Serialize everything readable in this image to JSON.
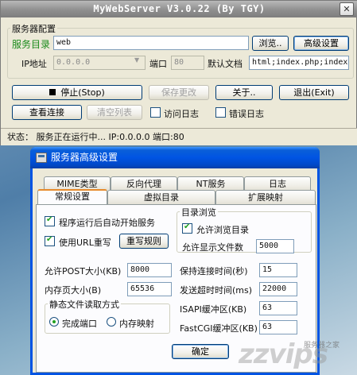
{
  "main": {
    "title": "MyWebServer V3.0.22 (By TGY)",
    "close_glyph": "✕",
    "group_title": "服务器配置",
    "dir_label": "服务目录",
    "dir_value": "web",
    "browse_label": "浏览..",
    "advanced_label": "高级设置",
    "ip_label": "IP地址",
    "ip_value": "0.0.0.0",
    "port_label": "端口",
    "port_value": "80",
    "default_doc_label": "默认文档",
    "default_doc_value": "html;index.php;index",
    "stop_label": "停止(Stop)",
    "save_label": "保存更改",
    "about_label": "关于..",
    "exit_label": "退出(Exit)",
    "view_conn_label": "查看连接",
    "clear_list_label": "清空列表",
    "access_log_label": "访问日志",
    "error_log_label": "错误日志",
    "status_text": "状态：  服务正在运行中...   IP:0.0.0.0   端口:80"
  },
  "dialog": {
    "title": "服务器高级设置",
    "tabs_row1": [
      "MIME类型",
      "反向代理",
      "NT服务",
      "日志"
    ],
    "tabs_row2": [
      "常规设置",
      "虚拟目录",
      "扩展映射"
    ],
    "auto_start_label": "程序运行后自动开始服务",
    "url_rewrite_label": "使用URL重写",
    "rewrite_rules_label": "重写规则",
    "dir_browse_group": "目录浏览",
    "allow_browse_label": "允许浏览目录",
    "max_files_label": "允许显示文件数",
    "max_files_value": "5000",
    "post_size_label": "允许POST大小(KB)",
    "post_size_value": "8000",
    "keepalive_label": "保持连接时间(秒)",
    "keepalive_value": "15",
    "mem_page_label": "内存页大小(B)",
    "mem_page_value": "65536",
    "send_timeout_label": "发送超时时间(ms)",
    "send_timeout_value": "22000",
    "isapi_buffer_label": "ISAPI缓冲区(KB)",
    "isapi_buffer_value": "63",
    "fastcgi_buffer_label": "FastCGI缓冲区(KB)",
    "fastcgi_buffer_value": "63",
    "static_group": "静态文件读取方式",
    "complete_port_label": "完成端口",
    "mem_map_label": "内存映射",
    "ok_label": "确定"
  },
  "watermark": {
    "logo": "zzvips",
    "sub": "服务器之家"
  },
  "colors": {
    "dialog_title_blue": "#0054e3",
    "tab_active_orange": "#e68b2c",
    "dir_label_green": "#1a8a1a"
  }
}
